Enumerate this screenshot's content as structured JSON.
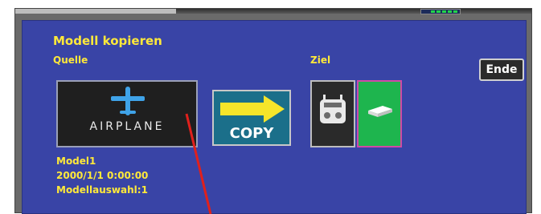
{
  "window": {
    "title": "Modell kopieren",
    "source_label": "Quelle",
    "target_label": "Ziel",
    "end_button_label": "Ende"
  },
  "source_model": {
    "type_label": "AIRPLANE",
    "name": "Model1",
    "date_time": "2000/1/1  0:00:00",
    "selection": "Modellauswahl:1"
  },
  "copy_button": {
    "label": "COPY"
  },
  "target": {
    "options": [
      {
        "icon": "transmitter-icon",
        "selected": false
      },
      {
        "icon": "sd-card-icon",
        "selected": true
      }
    ]
  },
  "colors": {
    "panel_bg": "#3944a6",
    "label_yellow": "#ffe93a",
    "selected_green": "#1eb54e",
    "selected_border": "#d04aa6",
    "pointer_red": "#e0201c"
  }
}
